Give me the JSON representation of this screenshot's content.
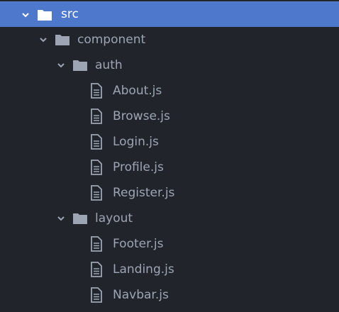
{
  "tree": {
    "root": {
      "label": "src"
    },
    "component": {
      "label": "component"
    },
    "auth": {
      "label": "auth",
      "files": [
        "About.js",
        "Browse.js",
        "Login.js",
        "Profile.js",
        "Register.js"
      ]
    },
    "layout": {
      "label": "layout",
      "files": [
        "Footer.js",
        "Landing.js",
        "Navbar.js"
      ]
    }
  },
  "colors": {
    "background": "#21252b",
    "selected": "#4d78cc",
    "text": "#9da5b4",
    "icon": "#9da5b4"
  },
  "icons": {
    "expanded": "chevron-down-icon",
    "folder": "folder-icon",
    "file": "file-icon"
  }
}
